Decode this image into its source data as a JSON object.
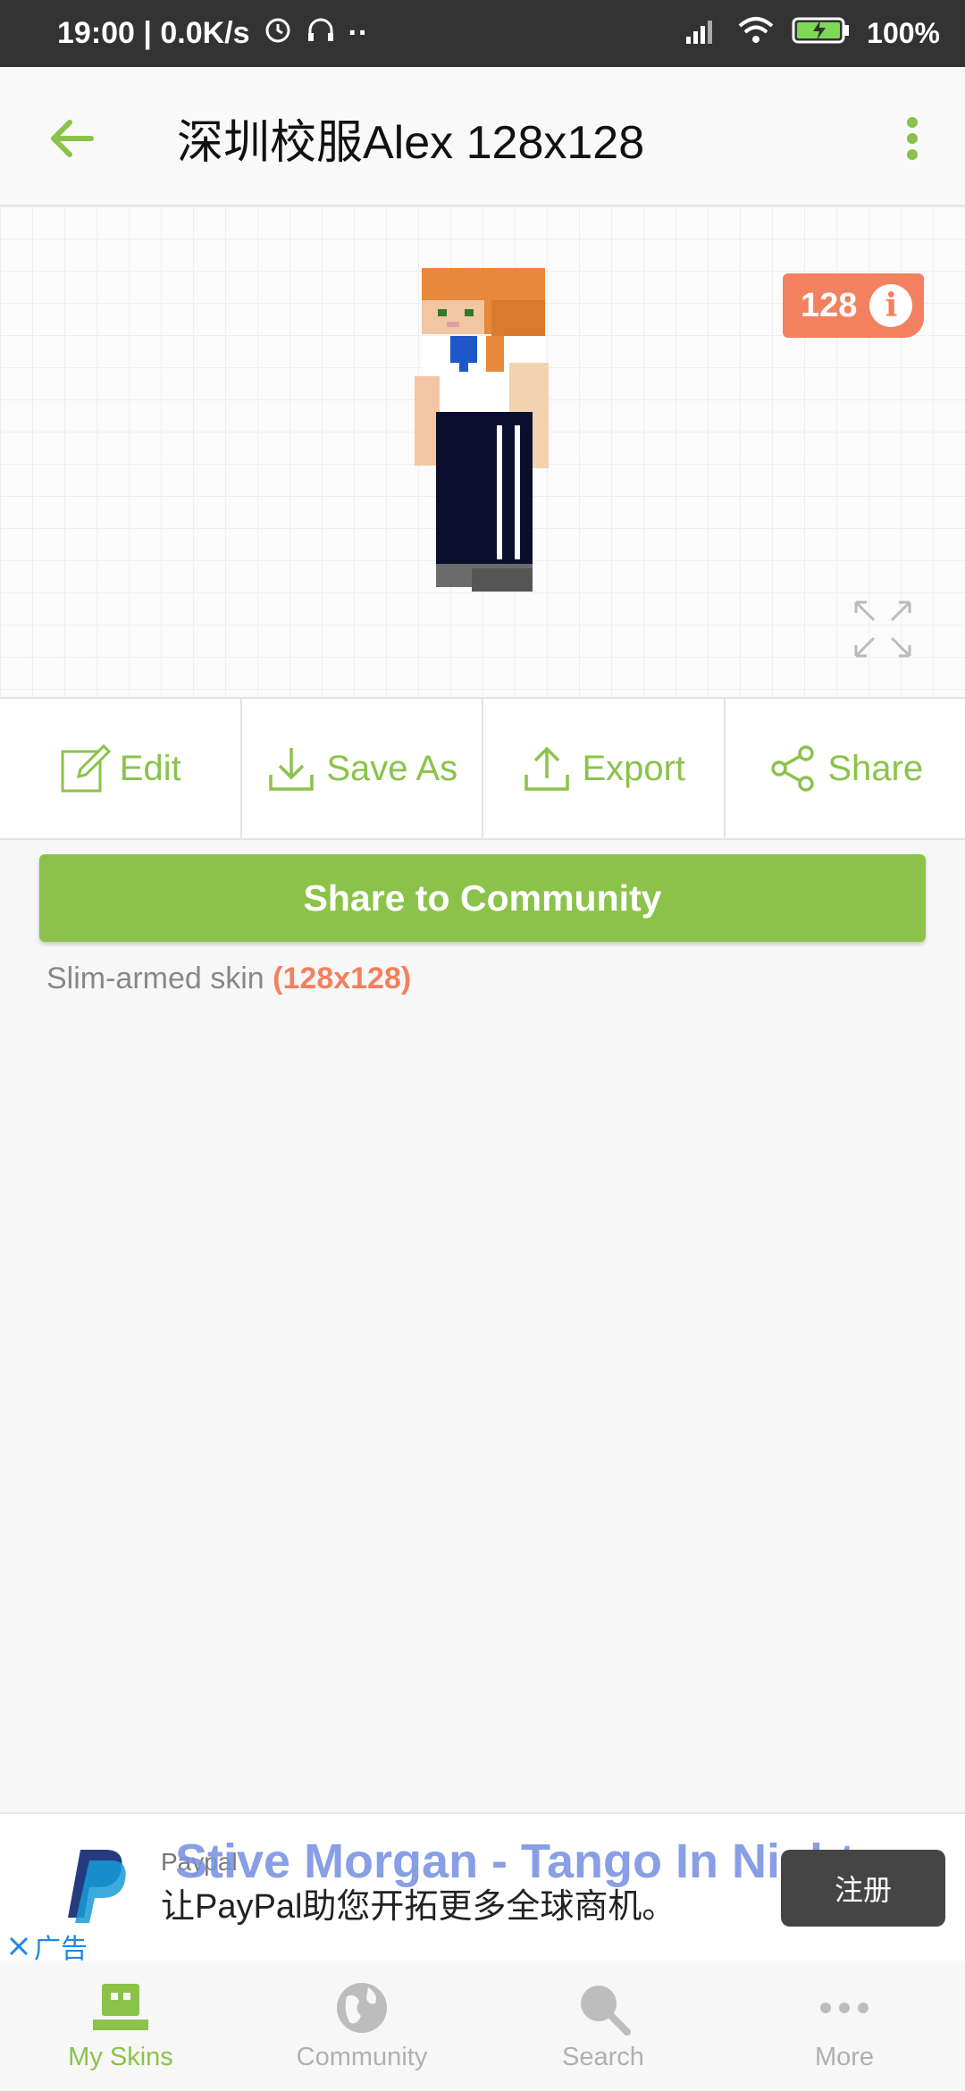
{
  "status_bar": {
    "time_speed": "19:00 | 0.0K/s",
    "more_dots": "··",
    "battery": "100%"
  },
  "app_bar": {
    "title": "深圳校服Alex 128x128"
  },
  "preview": {
    "resolution_badge": "128",
    "info_glyph": "i"
  },
  "actions": [
    {
      "label": "Edit",
      "icon": "edit-icon"
    },
    {
      "label": "Save As",
      "icon": "download-icon"
    },
    {
      "label": "Export",
      "icon": "upload-icon"
    },
    {
      "label": "Share",
      "icon": "share-icon"
    }
  ],
  "share_to_community": "Share to Community",
  "skin_info": {
    "type": "Slim-armed skin",
    "size": "(128x128)"
  },
  "ad": {
    "advertiser": "Paypal",
    "text": "让PayPal助您开拓更多全球商机。",
    "overlay_text": "Stive Morgan - Tango In Night",
    "cta": "注册",
    "close_label": "广告"
  },
  "bottom_nav": [
    {
      "label": "My Skins",
      "icon": "my-skins-icon",
      "active": true
    },
    {
      "label": "Community",
      "icon": "globe-icon",
      "active": false
    },
    {
      "label": "Search",
      "icon": "search-icon",
      "active": false
    },
    {
      "label": "More",
      "icon": "more-icon",
      "active": false
    }
  ],
  "colors": {
    "accent": "#8bc34a",
    "badge": "#f3805e",
    "status_bar": "#333333"
  }
}
